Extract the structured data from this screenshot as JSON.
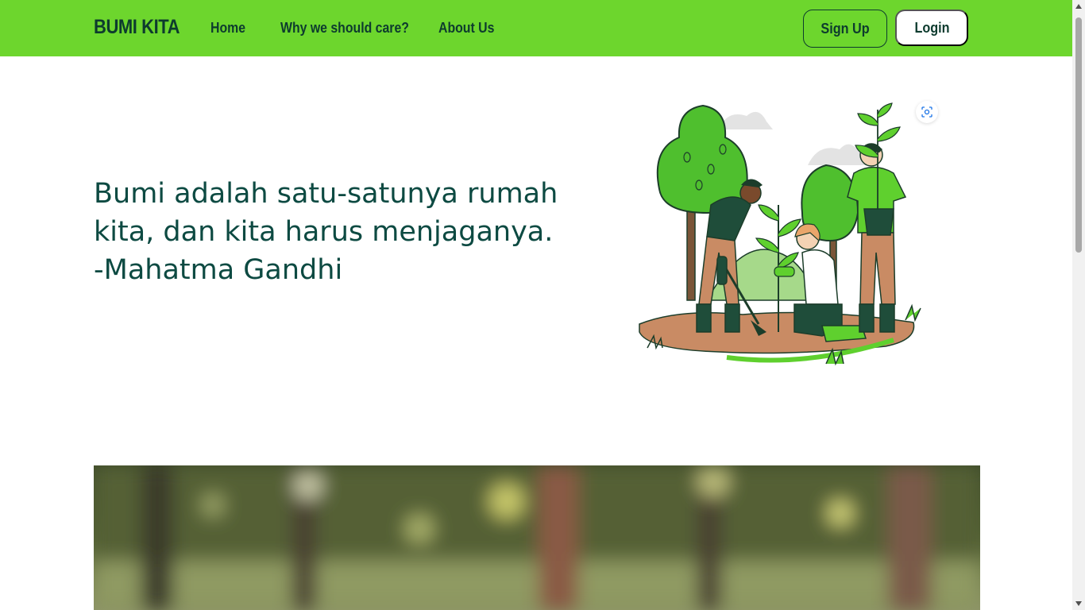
{
  "navbar": {
    "brand": "BUMI KITA",
    "links": [
      "Home",
      "Why we should care?",
      "About Us"
    ],
    "signup_label": "Sign Up",
    "login_label": "Login"
  },
  "hero": {
    "quote_lines": [
      "Bumi adalah satu-satunya rumah",
      "kita, dan kita harus menjaganya.",
      "-Mahatma Gandhi"
    ]
  },
  "icons": {
    "lens": "image-search-lens-icon",
    "scroll_up": "arrow-up-icon",
    "scroll_down": "arrow-down-icon"
  },
  "colors": {
    "nav_bg": "#6dd62d",
    "text_dark": "#0d3b2e",
    "quote_text": "#0d4a42",
    "white": "#ffffff"
  }
}
